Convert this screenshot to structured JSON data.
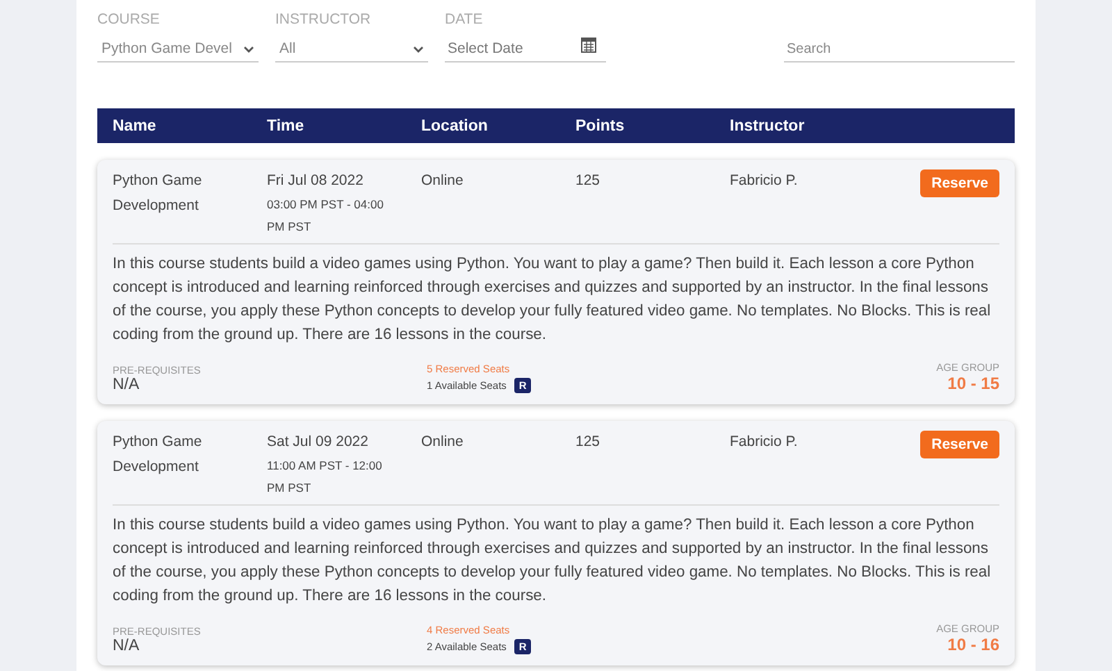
{
  "filters": {
    "course": {
      "label": "COURSE",
      "value": "Python Game Devel"
    },
    "instructor": {
      "label": "INSTRUCTOR",
      "value": "All"
    },
    "date": {
      "label": "DATE",
      "placeholder": "Select Date"
    },
    "search": {
      "placeholder": "Search"
    }
  },
  "table": {
    "columns": [
      "Name",
      "Time",
      "Location",
      "Points",
      "Instructor"
    ],
    "rows": [
      {
        "name": "Python Game Development",
        "date": "Fri Jul 08 2022",
        "time": "03:00 PM PST - 04:00 PM PST",
        "location": "Online",
        "points": "125",
        "instructor": "Fabricio P.",
        "button": "Reserve",
        "description": "In this course students build a video games using Python. You want to play a game? Then build it. Each lesson a core Python concept is introduced and learning reinforced through exercises and quizzes and supported by an instructor. In the final lessons of the course, you apply these Python concepts to develop your fully featured video game. No templates. No Blocks. This is real coding from the ground up. There are 16 lessons in the course.",
        "prereq_label": "PRE-REQUISITES",
        "prereq": "N/A",
        "reserved": "5 Reserved Seats",
        "available": "1 Available Seats",
        "badge": "R",
        "age_label": "AGE GROUP",
        "age": "10 - 15"
      },
      {
        "name": "Python Game Development",
        "date": "Sat Jul 09 2022",
        "time": "11:00 AM PST - 12:00 PM PST",
        "location": "Online",
        "points": "125",
        "instructor": "Fabricio P.",
        "button": "Reserve",
        "description": "In this course students build a video games using Python. You want to play a game? Then build it. Each lesson a core Python concept is introduced and learning reinforced through exercises and quizzes and supported by an instructor. In the final lessons of the course, you apply these Python concepts to develop your fully featured video game. No templates. No Blocks. This is real coding from the ground up. There are 16 lessons in the course.",
        "prereq_label": "PRE-REQUISITES",
        "prereq": "N/A",
        "reserved": "4 Reserved Seats",
        "available": "2 Available Seats",
        "badge": "R",
        "age_label": "AGE GROUP",
        "age": "10 - 16"
      }
    ]
  }
}
